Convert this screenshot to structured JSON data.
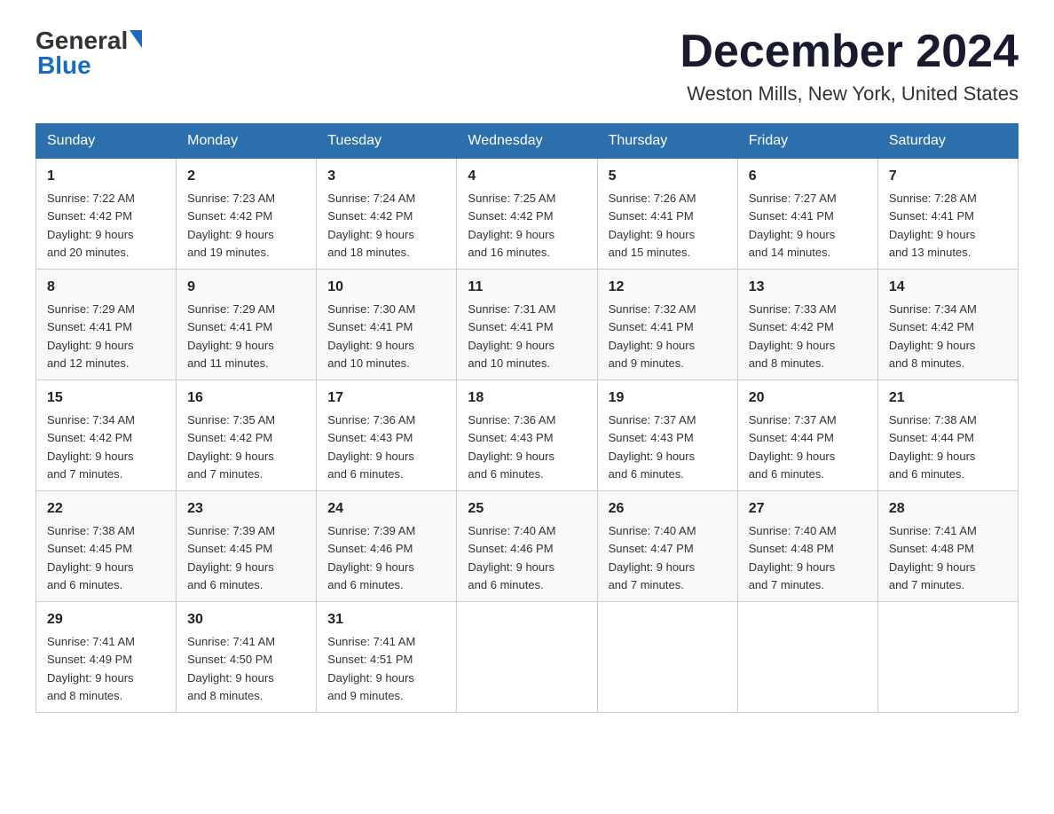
{
  "logo": {
    "general": "General",
    "blue": "Blue"
  },
  "header": {
    "month_year": "December 2024",
    "location": "Weston Mills, New York, United States"
  },
  "days_of_week": [
    "Sunday",
    "Monday",
    "Tuesday",
    "Wednesday",
    "Thursday",
    "Friday",
    "Saturday"
  ],
  "weeks": [
    [
      {
        "day": "1",
        "sunrise": "7:22 AM",
        "sunset": "4:42 PM",
        "daylight": "9 hours and 20 minutes."
      },
      {
        "day": "2",
        "sunrise": "7:23 AM",
        "sunset": "4:42 PM",
        "daylight": "9 hours and 19 minutes."
      },
      {
        "day": "3",
        "sunrise": "7:24 AM",
        "sunset": "4:42 PM",
        "daylight": "9 hours and 18 minutes."
      },
      {
        "day": "4",
        "sunrise": "7:25 AM",
        "sunset": "4:42 PM",
        "daylight": "9 hours and 16 minutes."
      },
      {
        "day": "5",
        "sunrise": "7:26 AM",
        "sunset": "4:41 PM",
        "daylight": "9 hours and 15 minutes."
      },
      {
        "day": "6",
        "sunrise": "7:27 AM",
        "sunset": "4:41 PM",
        "daylight": "9 hours and 14 minutes."
      },
      {
        "day": "7",
        "sunrise": "7:28 AM",
        "sunset": "4:41 PM",
        "daylight": "9 hours and 13 minutes."
      }
    ],
    [
      {
        "day": "8",
        "sunrise": "7:29 AM",
        "sunset": "4:41 PM",
        "daylight": "9 hours and 12 minutes."
      },
      {
        "day": "9",
        "sunrise": "7:29 AM",
        "sunset": "4:41 PM",
        "daylight": "9 hours and 11 minutes."
      },
      {
        "day": "10",
        "sunrise": "7:30 AM",
        "sunset": "4:41 PM",
        "daylight": "9 hours and 10 minutes."
      },
      {
        "day": "11",
        "sunrise": "7:31 AM",
        "sunset": "4:41 PM",
        "daylight": "9 hours and 10 minutes."
      },
      {
        "day": "12",
        "sunrise": "7:32 AM",
        "sunset": "4:41 PM",
        "daylight": "9 hours and 9 minutes."
      },
      {
        "day": "13",
        "sunrise": "7:33 AM",
        "sunset": "4:42 PM",
        "daylight": "9 hours and 8 minutes."
      },
      {
        "day": "14",
        "sunrise": "7:34 AM",
        "sunset": "4:42 PM",
        "daylight": "9 hours and 8 minutes."
      }
    ],
    [
      {
        "day": "15",
        "sunrise": "7:34 AM",
        "sunset": "4:42 PM",
        "daylight": "9 hours and 7 minutes."
      },
      {
        "day": "16",
        "sunrise": "7:35 AM",
        "sunset": "4:42 PM",
        "daylight": "9 hours and 7 minutes."
      },
      {
        "day": "17",
        "sunrise": "7:36 AM",
        "sunset": "4:43 PM",
        "daylight": "9 hours and 6 minutes."
      },
      {
        "day": "18",
        "sunrise": "7:36 AM",
        "sunset": "4:43 PM",
        "daylight": "9 hours and 6 minutes."
      },
      {
        "day": "19",
        "sunrise": "7:37 AM",
        "sunset": "4:43 PM",
        "daylight": "9 hours and 6 minutes."
      },
      {
        "day": "20",
        "sunrise": "7:37 AM",
        "sunset": "4:44 PM",
        "daylight": "9 hours and 6 minutes."
      },
      {
        "day": "21",
        "sunrise": "7:38 AM",
        "sunset": "4:44 PM",
        "daylight": "9 hours and 6 minutes."
      }
    ],
    [
      {
        "day": "22",
        "sunrise": "7:38 AM",
        "sunset": "4:45 PM",
        "daylight": "9 hours and 6 minutes."
      },
      {
        "day": "23",
        "sunrise": "7:39 AM",
        "sunset": "4:45 PM",
        "daylight": "9 hours and 6 minutes."
      },
      {
        "day": "24",
        "sunrise": "7:39 AM",
        "sunset": "4:46 PM",
        "daylight": "9 hours and 6 minutes."
      },
      {
        "day": "25",
        "sunrise": "7:40 AM",
        "sunset": "4:46 PM",
        "daylight": "9 hours and 6 minutes."
      },
      {
        "day": "26",
        "sunrise": "7:40 AM",
        "sunset": "4:47 PM",
        "daylight": "9 hours and 7 minutes."
      },
      {
        "day": "27",
        "sunrise": "7:40 AM",
        "sunset": "4:48 PM",
        "daylight": "9 hours and 7 minutes."
      },
      {
        "day": "28",
        "sunrise": "7:41 AM",
        "sunset": "4:48 PM",
        "daylight": "9 hours and 7 minutes."
      }
    ],
    [
      {
        "day": "29",
        "sunrise": "7:41 AM",
        "sunset": "4:49 PM",
        "daylight": "9 hours and 8 minutes."
      },
      {
        "day": "30",
        "sunrise": "7:41 AM",
        "sunset": "4:50 PM",
        "daylight": "9 hours and 8 minutes."
      },
      {
        "day": "31",
        "sunrise": "7:41 AM",
        "sunset": "4:51 PM",
        "daylight": "9 hours and 9 minutes."
      },
      null,
      null,
      null,
      null
    ]
  ],
  "labels": {
    "sunrise": "Sunrise:",
    "sunset": "Sunset:",
    "daylight": "Daylight:"
  }
}
